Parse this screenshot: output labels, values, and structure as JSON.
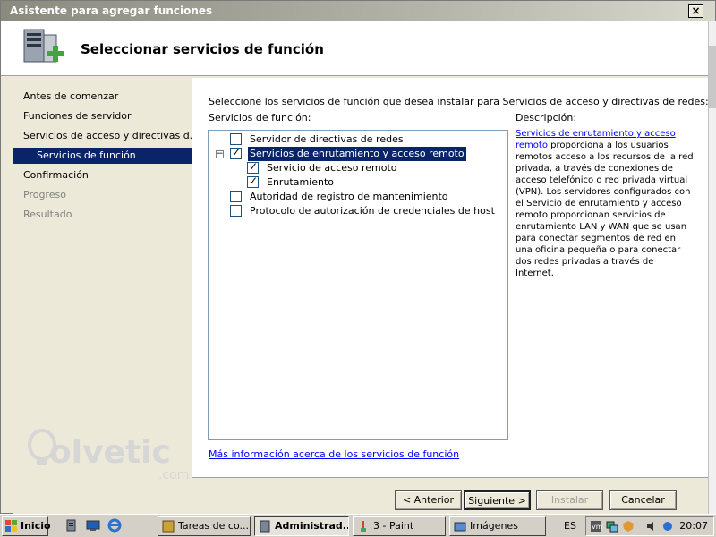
{
  "window": {
    "title": "Asistente para agregar funciones",
    "close_glyph": "×"
  },
  "header": {
    "title": "Seleccionar servicios de función",
    "icon": "server-add-icon"
  },
  "nav": {
    "items": [
      {
        "label": "Antes de comenzar",
        "state": "normal"
      },
      {
        "label": "Funciones de servidor",
        "state": "normal"
      },
      {
        "label": "Servicios de acceso y directivas d...",
        "state": "normal"
      },
      {
        "label": "Servicios de función",
        "state": "selected"
      },
      {
        "label": "Confirmación",
        "state": "normal"
      },
      {
        "label": "Progreso",
        "state": "disabled"
      },
      {
        "label": "Resultado",
        "state": "disabled"
      }
    ]
  },
  "watermark": {
    "text": "olvetic",
    "suffix": ".com"
  },
  "content": {
    "instruction": "Seleccione los servicios de función que desea instalar para Servicios de acceso y directivas de redes:",
    "services_label": "Servicios de función:",
    "description_label": "Descripción:",
    "tree": [
      {
        "label": "Servidor de directivas de redes",
        "checked": false,
        "level": 0,
        "selected": false
      },
      {
        "label": "Servicios de enrutamiento y acceso remoto",
        "checked": true,
        "level": 0,
        "selected": true,
        "expander": "−"
      },
      {
        "label": "Servicio de acceso remoto",
        "checked": true,
        "level": 1,
        "selected": false
      },
      {
        "label": "Enrutamiento",
        "checked": true,
        "level": 1,
        "selected": false
      },
      {
        "label": "Autoridad de registro de mantenimiento",
        "checked": false,
        "level": 0,
        "selected": false
      },
      {
        "label": "Protocolo de autorización de credenciales de host",
        "checked": false,
        "level": 0,
        "selected": false
      }
    ],
    "description_link": "Servicios de enrutamiento y acceso remoto",
    "description_text": " proporciona a los usuarios remotos acceso a los recursos de la red privada, a través de conexiones de acceso telefónico o red privada virtual (VPN). Los servidores configurados con el Servicio de enrutamiento y acceso remoto proporcionan servicios de enrutamiento LAN y WAN que se usan para conectar segmentos de red en una oficina pequeña o para conectar dos redes privadas a través de Internet.",
    "more_info": "Más información acerca de los servicios de función"
  },
  "buttons": {
    "back": "< Anterior",
    "next": "Siguiente >",
    "install": "Instalar",
    "cancel": "Cancelar"
  },
  "taskbar": {
    "start": "Inicio",
    "tasks": [
      {
        "label": "Tareas de co...",
        "active": false
      },
      {
        "label": "Administrad...",
        "active": true
      },
      {
        "label": "3 - Paint",
        "active": false
      },
      {
        "label": "Imágenes",
        "active": false
      }
    ],
    "lang": "ES",
    "clock": "20:07"
  }
}
